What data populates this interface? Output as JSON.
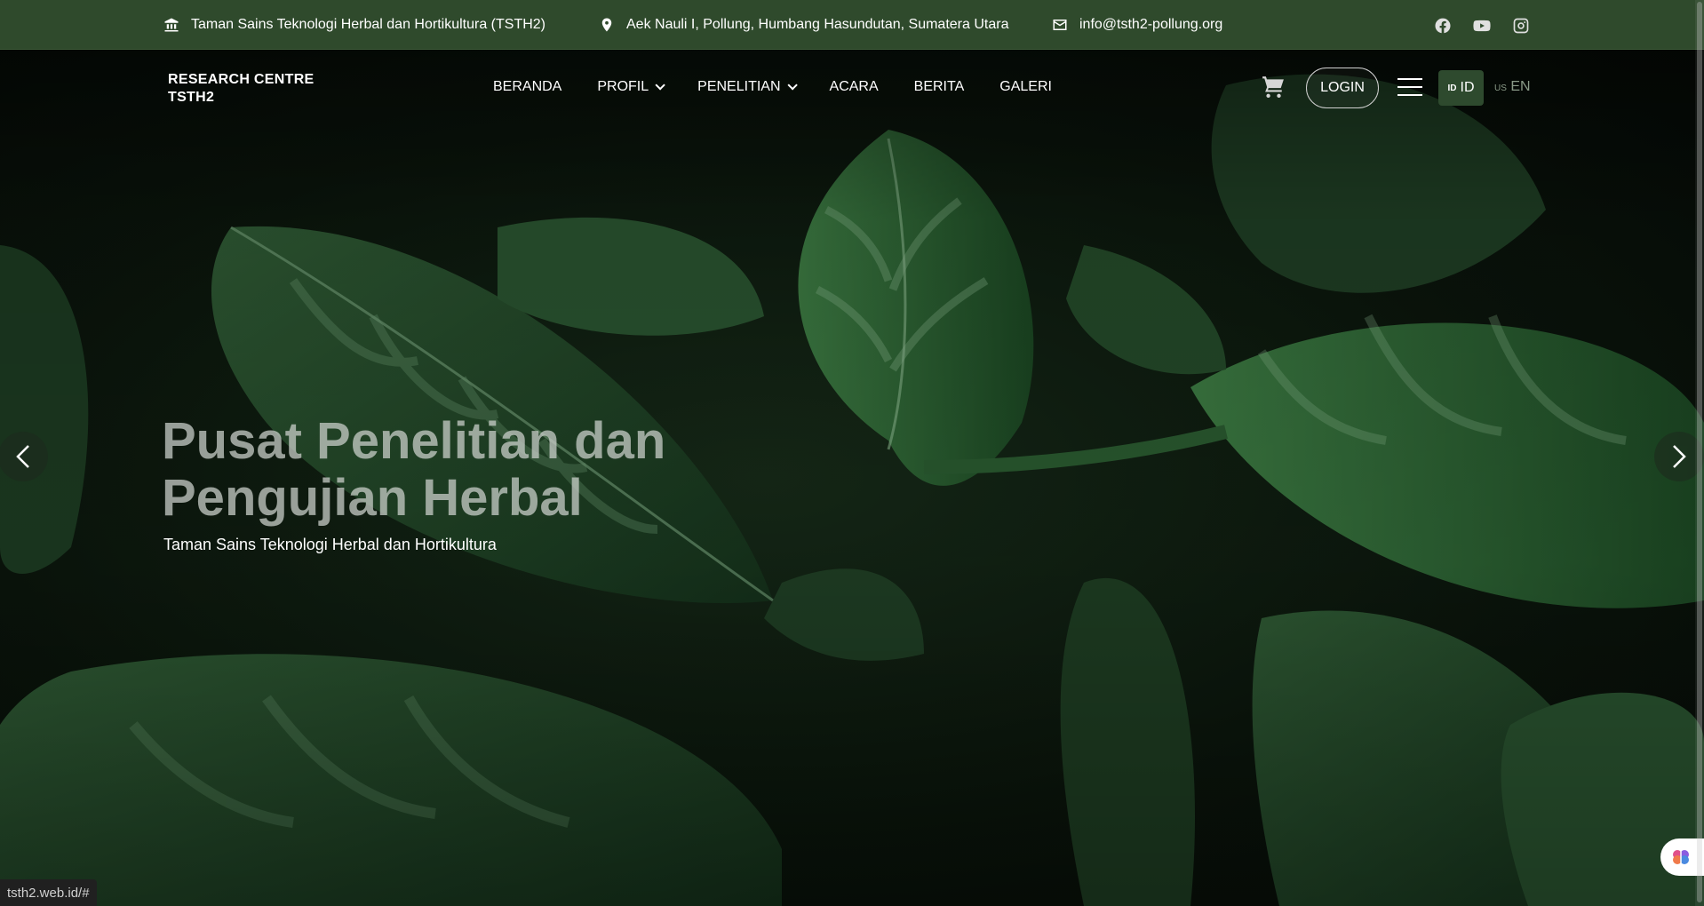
{
  "topbar": {
    "institution": "Taman Sains Teknologi Herbal dan Hortikultura (TSTH2)",
    "address": "Aek Nauli I, Pollung, Humbang Hasundutan, Sumatera Utara",
    "email": "info@tsth2-pollung.org",
    "socials": [
      "facebook-icon",
      "youtube-icon",
      "instagram-icon"
    ]
  },
  "brand": {
    "line1": "RESEARCH CENTRE",
    "line2": "TSTH2"
  },
  "nav": {
    "items": [
      {
        "label": "BERANDA"
      },
      {
        "label": "PROFIL"
      },
      {
        "label": "PENELITIAN"
      },
      {
        "label": "ACARA"
      },
      {
        "label": "BERITA"
      },
      {
        "label": "GALERI"
      }
    ]
  },
  "header": {
    "login_label": "LOGIN",
    "lang_id_flag": "ID",
    "lang_id_label": "ID",
    "lang_en_flag": "US",
    "lang_en_label": "EN"
  },
  "hero": {
    "title_line1": "Pusat Penelitian dan",
    "title_line2": "Pengujian Herbal",
    "subtitle": "Taman Sains Teknologi Herbal dan Hortikultura"
  },
  "status_url": "tsth2.web.id/#",
  "colors": {
    "topbar": "#2f4a2c",
    "lang_active": "#2e4a2e",
    "leaf_dark": "#1e3d22",
    "leaf_light": "#6c9a72"
  }
}
